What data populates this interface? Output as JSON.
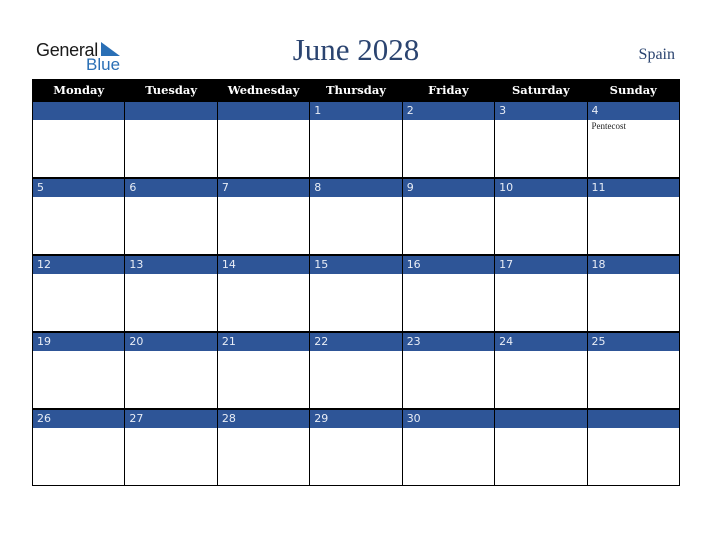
{
  "brand": {
    "line1": "General",
    "line2": "Blue",
    "accent": "#2a6fb5"
  },
  "title": "June 2028",
  "country": "Spain",
  "colors": {
    "header_bg": "#000000",
    "date_bar_bg": "#2e5597",
    "title_color": "#2b4470"
  },
  "weekdays": [
    "Monday",
    "Tuesday",
    "Wednesday",
    "Thursday",
    "Friday",
    "Saturday",
    "Sunday"
  ],
  "weeks": [
    [
      {
        "day": "",
        "event": ""
      },
      {
        "day": "",
        "event": ""
      },
      {
        "day": "",
        "event": ""
      },
      {
        "day": "1",
        "event": ""
      },
      {
        "day": "2",
        "event": ""
      },
      {
        "day": "3",
        "event": ""
      },
      {
        "day": "4",
        "event": "Pentecost"
      }
    ],
    [
      {
        "day": "5",
        "event": ""
      },
      {
        "day": "6",
        "event": ""
      },
      {
        "day": "7",
        "event": ""
      },
      {
        "day": "8",
        "event": ""
      },
      {
        "day": "9",
        "event": ""
      },
      {
        "day": "10",
        "event": ""
      },
      {
        "day": "11",
        "event": ""
      }
    ],
    [
      {
        "day": "12",
        "event": ""
      },
      {
        "day": "13",
        "event": ""
      },
      {
        "day": "14",
        "event": ""
      },
      {
        "day": "15",
        "event": ""
      },
      {
        "day": "16",
        "event": ""
      },
      {
        "day": "17",
        "event": ""
      },
      {
        "day": "18",
        "event": ""
      }
    ],
    [
      {
        "day": "19",
        "event": ""
      },
      {
        "day": "20",
        "event": ""
      },
      {
        "day": "21",
        "event": ""
      },
      {
        "day": "22",
        "event": ""
      },
      {
        "day": "23",
        "event": ""
      },
      {
        "day": "24",
        "event": ""
      },
      {
        "day": "25",
        "event": ""
      }
    ],
    [
      {
        "day": "26",
        "event": ""
      },
      {
        "day": "27",
        "event": ""
      },
      {
        "day": "28",
        "event": ""
      },
      {
        "day": "29",
        "event": ""
      },
      {
        "day": "30",
        "event": ""
      },
      {
        "day": "",
        "event": ""
      },
      {
        "day": "",
        "event": ""
      }
    ]
  ]
}
